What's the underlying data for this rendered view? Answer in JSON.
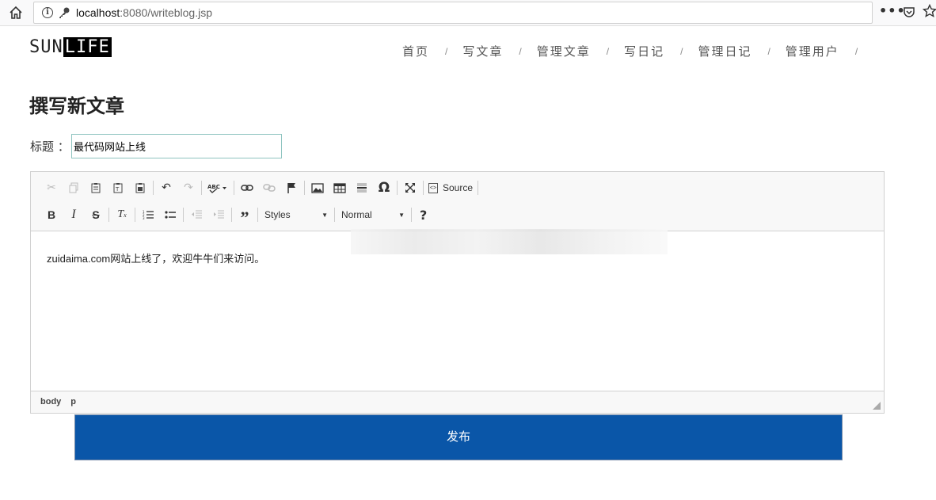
{
  "browser": {
    "url_host": "localhost",
    "url_rest": ":8080/writeblog.jsp",
    "menu_dots": "•••"
  },
  "site": {
    "logo_part1": "SUN",
    "logo_part2": "LIFE",
    "nav": [
      {
        "label": "首页"
      },
      {
        "label": "写文章"
      },
      {
        "label": "管理文章"
      },
      {
        "label": "写日记"
      },
      {
        "label": "管理日记"
      },
      {
        "label": "管理用户"
      }
    ],
    "nav_separator": "/"
  },
  "page": {
    "title": "撰写新文章",
    "title_label": "标题 ：",
    "title_value": "最代码网站上线"
  },
  "editor": {
    "source_label": "Source",
    "styles_label": "Styles",
    "format_label": "Normal",
    "help_label": "?",
    "content": "zuidaima.com网站上线了，欢迎牛牛们来访问。",
    "path": [
      "body",
      "p"
    ]
  },
  "actions": {
    "publish_label": "发布"
  },
  "colors": {
    "publish_bg": "#0a56a8",
    "input_border": "#8ec4c0"
  }
}
